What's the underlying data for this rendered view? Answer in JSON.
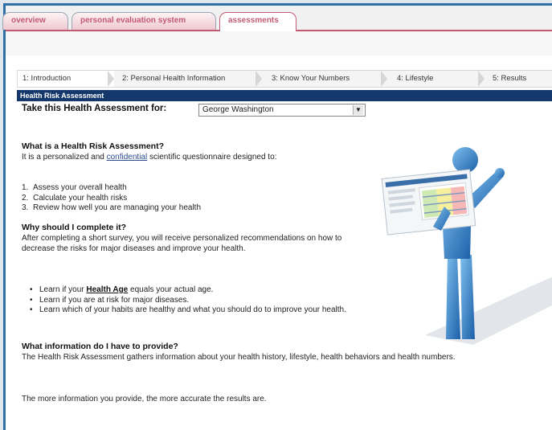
{
  "tabs": [
    {
      "label": "overview"
    },
    {
      "label": "personal evaluation system"
    },
    {
      "label": "assessments"
    }
  ],
  "steps": [
    {
      "label": "1: Introduction"
    },
    {
      "label": "2: Personal Health Information"
    },
    {
      "label": "3: Know Your Numbers"
    },
    {
      "label": "4: Lifestyle"
    },
    {
      "label": "5: Results"
    }
  ],
  "header": "Health Risk Assessment",
  "take_for_label": "Take this Health Assessment for:",
  "take_for_value": "George Washington",
  "what_heading": "What is a Health Risk Assessment?",
  "what_text_before": "It is a personalized and ",
  "what_link": "confidential",
  "what_text_after": " scientific questionnaire designed to:",
  "purposes": [
    {
      "num": "1.",
      "text": "Assess your overall health"
    },
    {
      "num": "2.",
      "text": "Calculate your health risks"
    },
    {
      "num": "3.",
      "text": "Review how well you are managing your health"
    }
  ],
  "why_heading": "Why should I complete it?",
  "why_text": "After completing a short survey, you will receive personalized recommendations on how to decrease the risks for major diseases and improve your health.",
  "benefits": {
    "b1_before": "Learn if your ",
    "b1_link": "Health Age",
    "b1_after": " equals your actual age.",
    "b2": "Learn if you are at risk for major diseases.",
    "b3": "Learn which of your habits are healthy and what you should do to improve your health."
  },
  "info_heading": "What information do I have to provide?",
  "info_text": "The Health Risk Assessment gathers information about your health history, lifestyle, health behaviors and health numbers.",
  "more_text": "The more information you provide, the more accurate the results are."
}
